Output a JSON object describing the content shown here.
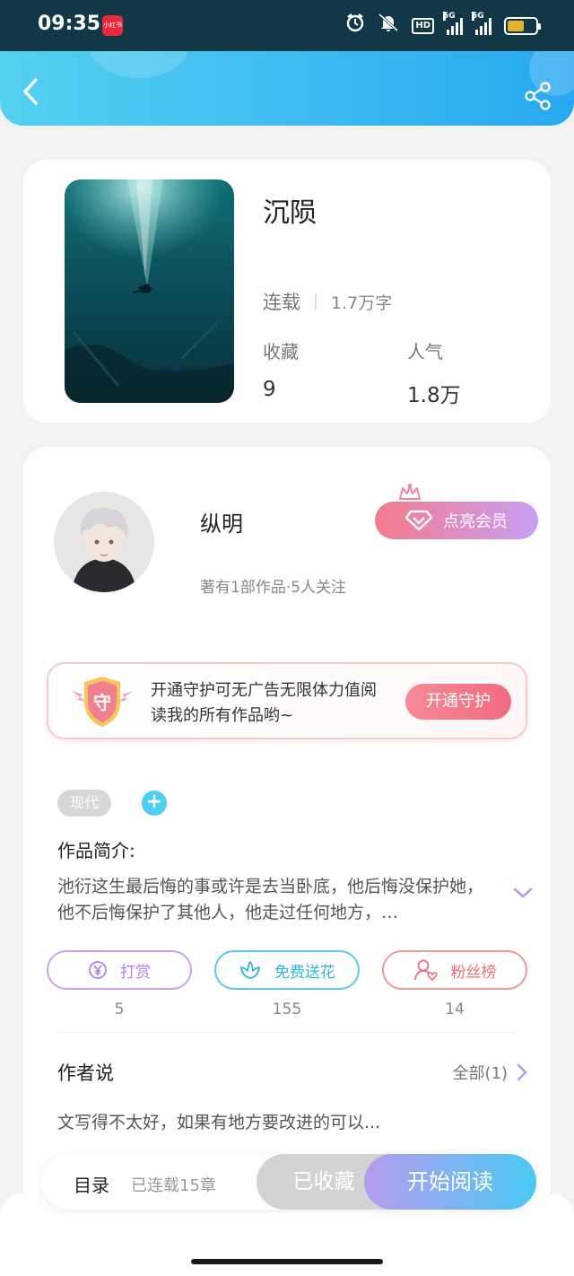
{
  "status_bar": {
    "time": "09:35",
    "app_badge": "小红书",
    "hd_label": "HD",
    "signal1_label": "5G",
    "signal2_label": "5G",
    "battery_level": 0.6,
    "battery_color": "#e3b22c"
  },
  "header": {
    "back_icon": "chevron-left-icon",
    "share_icon": "share-icon",
    "gradient": [
      "#55d0f0",
      "#28a8f0"
    ]
  },
  "book": {
    "title": "沉陨",
    "status": "连载",
    "word_count": "1.7万字",
    "fav_label": "收藏",
    "fav_value": "9",
    "popularity_label": "人气",
    "popularity_value": "1.8万"
  },
  "author": {
    "name": "纵明",
    "meta": "著有1部作品·5人关注",
    "vip_button": "点亮会员"
  },
  "guard": {
    "badge_char": "守",
    "text": "开通守护可无广告无限体力值阅读我的所有作品哟~",
    "button": "开通守护"
  },
  "tags": [
    "现代"
  ],
  "tag_add_symbol": "+",
  "intro": {
    "title": "作品简介:",
    "text": "池衍这生最后悔的事或许是去当卧底，他后悔没保护她，他不后悔保护了其他人，他走过任何地方，…"
  },
  "actions": [
    {
      "label": "打赏",
      "count": "5",
      "icon": "yuan-coin-icon"
    },
    {
      "label": "免费送花",
      "count": "155",
      "icon": "flower-icon"
    },
    {
      "label": "粉丝榜",
      "count": "14",
      "icon": "fans-user-heart-icon"
    }
  ],
  "author_says": {
    "title": "作者说",
    "all_label": "全部(1)",
    "text": "文写得不太好，如果有地方要改进的可以..."
  },
  "bottom_bar": {
    "toc_label": "目录",
    "toc_meta": "已连载15章",
    "fav_button": "已收藏",
    "read_button": "开始阅读"
  },
  "colors": {
    "accent_blue": "#28a8f0",
    "vip_pink": "#f47b8c",
    "guard_pink": "#f26b7f",
    "reward_purple": "#b07ee8",
    "flower_cyan": "#2fb6dc",
    "fans_red": "#ec6f77"
  }
}
